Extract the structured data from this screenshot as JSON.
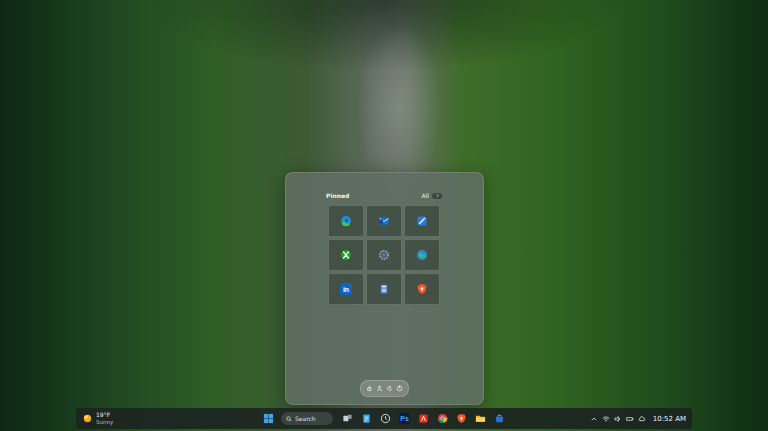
{
  "start_menu": {
    "section_title": "Pinned",
    "all_button": "All",
    "pinned_apps": [
      {
        "kind": "edge"
      },
      {
        "kind": "outlook"
      },
      {
        "kind": "whiteboard"
      },
      {
        "kind": "xbox"
      },
      {
        "kind": "settings"
      },
      {
        "kind": "globe"
      },
      {
        "kind": "linkedin",
        "glyph": "in"
      },
      {
        "kind": "calculator"
      },
      {
        "kind": "brave"
      }
    ]
  },
  "taskbar": {
    "weather": {
      "temperature": "19°F",
      "condition": "Sunny"
    },
    "search": {
      "placeholder": "Search"
    },
    "apps": [
      {
        "kind": "task-view"
      },
      {
        "kind": "notepad"
      },
      {
        "kind": "clock"
      },
      {
        "kind": "photoshop",
        "glyph": "Ps"
      },
      {
        "kind": "acrobat"
      },
      {
        "kind": "chrome"
      },
      {
        "kind": "brave"
      },
      {
        "kind": "explorer"
      },
      {
        "kind": "mail"
      }
    ],
    "clock": {
      "time": "10:52 AM"
    }
  }
}
